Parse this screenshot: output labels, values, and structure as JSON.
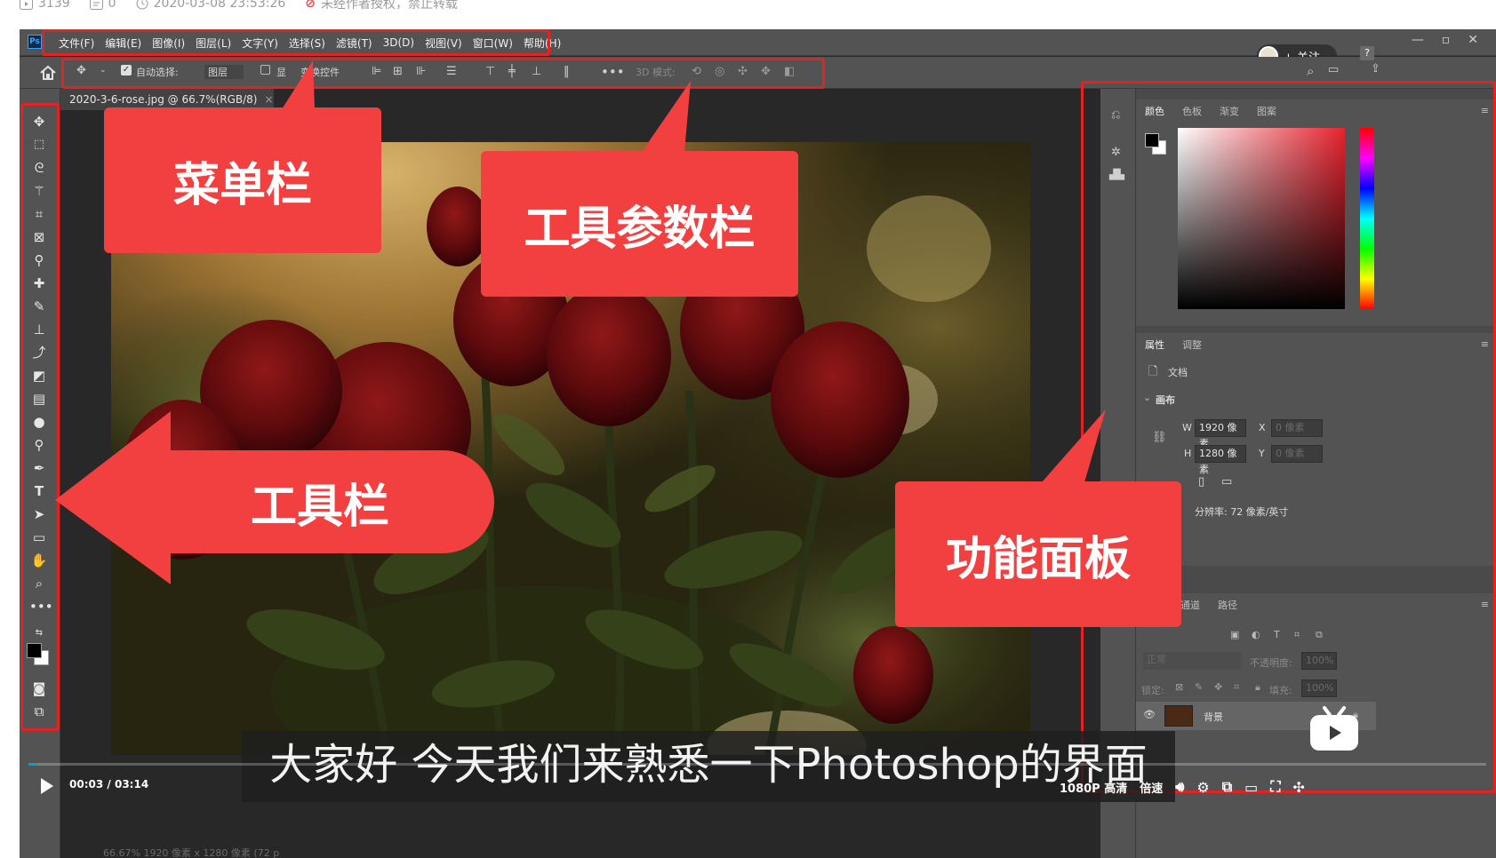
{
  "page_meta": {
    "views": "3139",
    "comments": "0",
    "date": "2020-03-08 23:53:26",
    "copyright": "未经作者授权，禁止转载"
  },
  "ps": {
    "logo": "Ps",
    "menu": [
      "文件(F)",
      "编辑(E)",
      "图像(I)",
      "图层(L)",
      "文字(Y)",
      "选择(S)",
      "滤镜(T)",
      "3D(D)",
      "视图(V)",
      "窗口(W)",
      "帮助(H)"
    ],
    "options": {
      "auto_select": "自动选择:",
      "layer_dropdown": "图层",
      "show_transform_a": "显",
      "show_transform_b": "变换控件",
      "mode_3d": "3D 模式:"
    },
    "doc_tab": "2020-3-6-rose.jpg @ 66.7%(RGB/8)",
    "doc_tab_close": "×",
    "panels": {
      "color_tabs": [
        "颜色",
        "色板",
        "渐变",
        "图案"
      ],
      "props_tabs": [
        "属性",
        "调整"
      ],
      "document_label": "文档",
      "canvas_label": "画布",
      "w_label": "W",
      "w_value": "1920 像素",
      "h_label": "H",
      "h_value": "1280 像素",
      "x_label": "X",
      "x_placeholder": "0 像素",
      "y_label": "Y",
      "y_placeholder": "0 像素",
      "resolution": "分辨率: 72 像素/英寸",
      "layers_tabs": [
        "通道",
        "路径"
      ],
      "blend_mode": "正常",
      "opacity_label": "不透明度:",
      "opacity_value": "100%",
      "lock_label": "锁定:",
      "fill_label": "填充:",
      "fill_value": "100%",
      "layer_name": "背景"
    },
    "status_faded": "66.67%    1920 像素 x 1280 像素 (72 p"
  },
  "callouts": {
    "menu_bar": "菜单栏",
    "options_bar": "工具参数栏",
    "toolbar": "工具栏",
    "panels": "功能面板"
  },
  "player": {
    "follow": "+ 关注",
    "time_current": "00:03",
    "time_sep": "/",
    "time_total": "03:14",
    "quality": "1080P 高清",
    "speed": "倍速",
    "subtitle": "大家好 今天我们来熟悉一下Photoshop的界面",
    "progress": 0.006
  },
  "colors": {
    "highlight": "#e52222",
    "callout": "#f24040",
    "ps_panel": "#535353",
    "progress": "#00a1d6"
  }
}
